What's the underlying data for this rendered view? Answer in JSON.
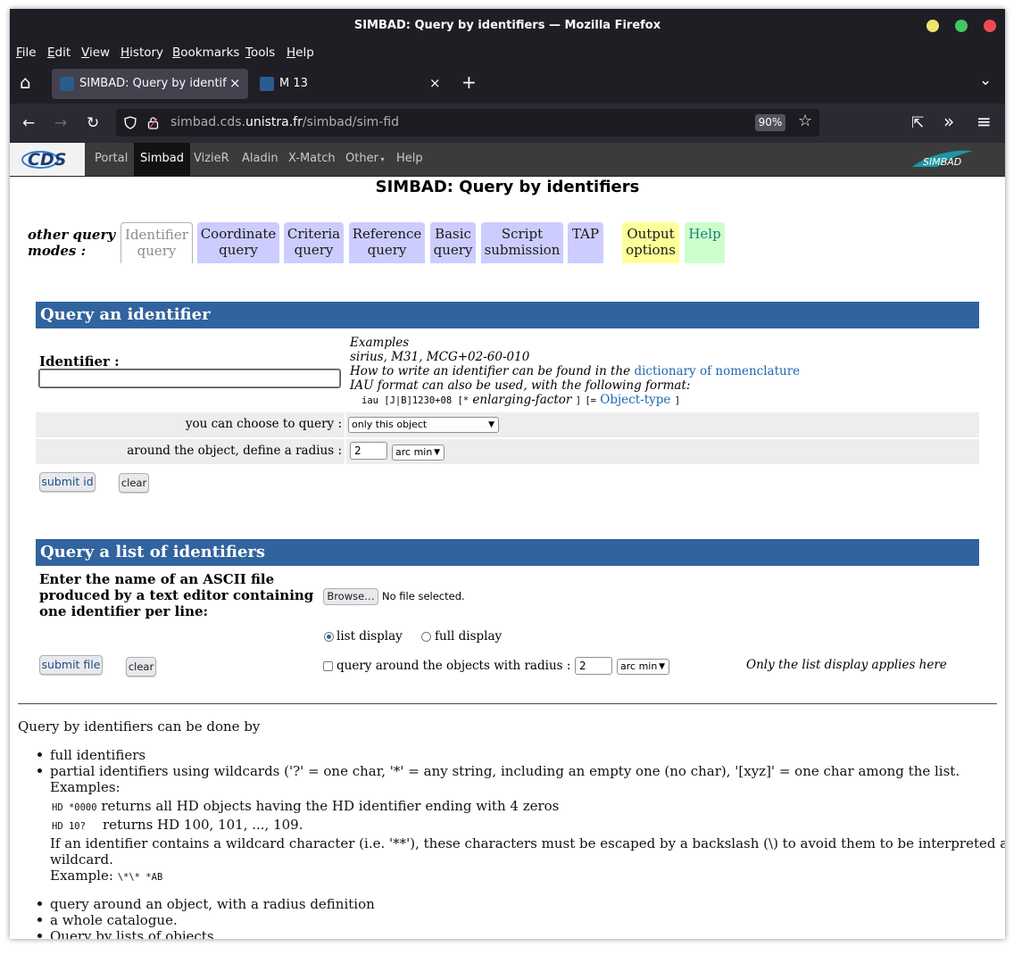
{
  "window": {
    "title": "SIMBAD: Query by identifiers — Mozilla Firefox",
    "controls": {
      "minimize_color": "#f0e36a",
      "maximize_color": "#44c760",
      "close_color": "#f04a57"
    }
  },
  "menubar": [
    "File",
    "Edit",
    "View",
    "History",
    "Bookmarks",
    "Tools",
    "Help"
  ],
  "tabs": [
    {
      "label": "SIMBAD: Query by identifie",
      "close": "×",
      "active": true
    },
    {
      "label": "M 13",
      "close": "×",
      "active": false
    }
  ],
  "tabbar_icons": {
    "home": "⌂",
    "new_tab": "+",
    "list_all": "⌄"
  },
  "navbar": {
    "url_host": "simbad.cds.",
    "url_domain": "unistra.fr",
    "url_path": "/simbad/sim-fid",
    "zoom": "90%",
    "back": "←",
    "forward": "→",
    "reload": "↻",
    "bookmark": "☆",
    "extensions": "⇱",
    "overflow": "»",
    "menu": "≡"
  },
  "cds_nav": [
    "Portal",
    "Simbad",
    "VizieR",
    "Aladin",
    "X-Match",
    "Other",
    "Help"
  ],
  "cds_nav_selected": "Simbad",
  "cds_logo_text": "CDS",
  "simbad_logo_text": "SIMBAD",
  "page_title": "SIMBAD: Query by identifiers",
  "query_modes": {
    "label_line1": "other query",
    "label_line2": "modes :",
    "buttons": [
      {
        "l1": "Identifier",
        "l2": "query",
        "color": "#ffffff"
      },
      {
        "l1": "Coordinate",
        "l2": "query",
        "color": "#ccccff"
      },
      {
        "l1": "Criteria",
        "l2": "query",
        "color": "#ccccff"
      },
      {
        "l1": "Reference",
        "l2": "query",
        "color": "#ccccff"
      },
      {
        "l1": "Basic",
        "l2": "query",
        "color": "#ccccff"
      },
      {
        "l1": "Script",
        "l2": "submission",
        "color": "#ccccff"
      },
      {
        "l1": "TAP",
        "l2": "",
        "color": "#ccccff"
      },
      {
        "l1": "Output",
        "l2": "options",
        "color": "#ffff99"
      },
      {
        "l1": "Help",
        "l2": "",
        "color": "#ccffcc"
      }
    ]
  },
  "query_identifier": {
    "header": "Query an identifier",
    "identifier_label": "Identifier :",
    "identifier_value": "",
    "examples_title": "Examples",
    "examples_list": "sirius, M31, MCG+02-60-010",
    "howto_prefix": "How to write an identifier can be found in the ",
    "howto_link": "dictionary of nomenclature",
    "iau_line": "IAU format can also be used, with the following format:",
    "iau_format": "iau [J|B]1230+08 [*",
    "enlarging": "enlarging-factor",
    "bracket_close": "]",
    "obj_prefix": "[=",
    "object_type_link": "Object-type",
    "obj_close": "]",
    "choose_label": "you can choose to query :",
    "choose_value": "only this object",
    "radius_label": "around the object, define a radius :",
    "radius_value": "2",
    "radius_unit": "arc min",
    "submit": "submit id",
    "clear": "clear"
  },
  "query_list": {
    "header": "Query a list of identifiers",
    "file_label_l1": "Enter the name of an ASCII file",
    "file_label_l2": "produced by a text editor containing",
    "file_label_l3": "one identifier per line:",
    "browse": "Browse…",
    "no_file": "No file selected.",
    "list_display": "list display",
    "full_display": "full display",
    "around_label": "query around the objects with radius :",
    "radius_value": "2",
    "radius_unit": "arc min",
    "note": "Only the list display applies here",
    "submit": "submit file",
    "clear": "clear"
  },
  "info": {
    "intro": "Query by identifiers can be done by",
    "b1": "full identifiers",
    "b2": "partial identifiers using wildcards ('?' = one char, '*' = any string, including an empty one (no char), '[xyz]' = one char among the list.",
    "examples": "Examples:",
    "ex1_code": "HD *0000",
    "ex1_text": "returns all HD objects having the HD identifier ending with 4 zeros",
    "ex2_code": "HD 10?",
    "ex2_text": "returns HD 100, 101, ..., 109.",
    "escape_l1": "If an identifier contains a wildcard character (i.e. '**'), these characters must be escaped by a backslash (\\) to avoid them to be interpreted as a",
    "escape_l2": "wildcard.",
    "example_label": "Example:",
    "example_code": "\\*\\* *AB",
    "b3": "query around an object, with a radius definition",
    "b4": "a whole catalogue.",
    "b5": "Query by lists of objects"
  }
}
